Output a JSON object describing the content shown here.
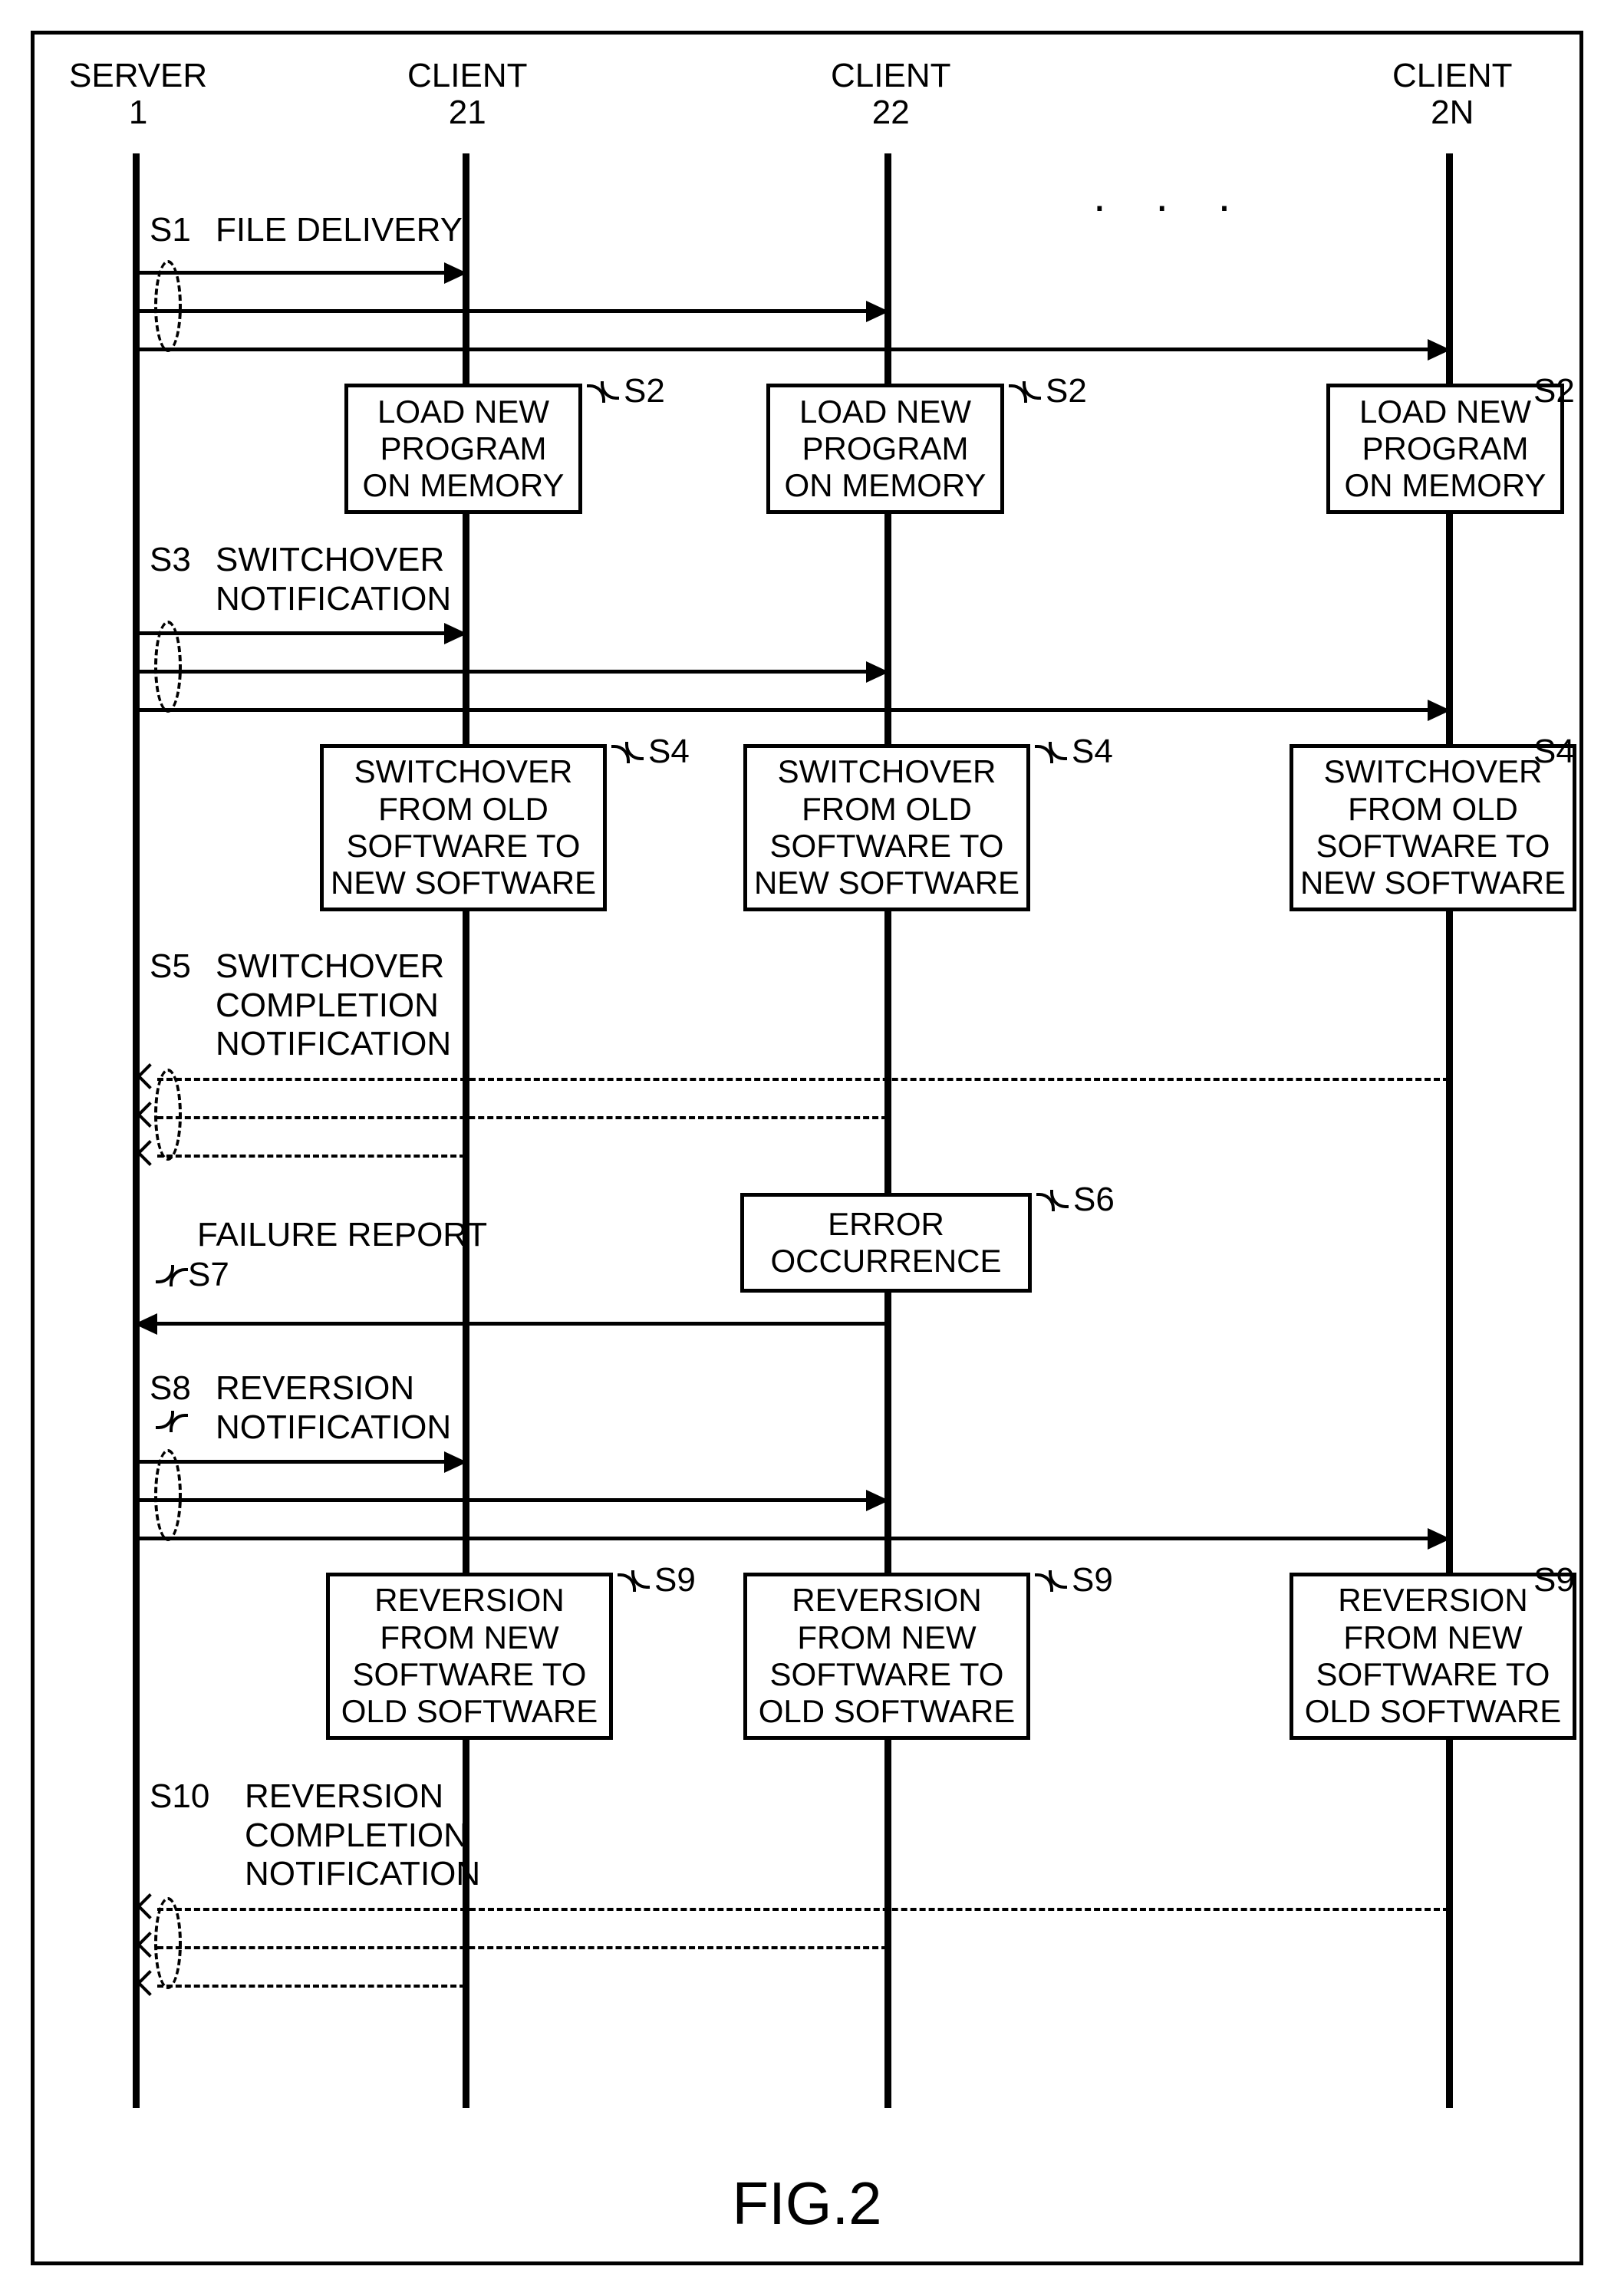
{
  "lifelines": {
    "server": {
      "label": "SERVER\n1"
    },
    "c21": {
      "label": "CLIENT\n21"
    },
    "c22": {
      "label": "CLIENT\n22"
    },
    "c2n": {
      "label": "CLIENT\n2N"
    }
  },
  "labels": {
    "S1": "S1",
    "S2": "S2",
    "S3": "S3",
    "S4": "S4",
    "S5": "S5",
    "S6": "S6",
    "S7": "S7",
    "S8": "S8",
    "S9": "S9",
    "S10": "S10"
  },
  "messages": {
    "file_delivery": "FILE DELIVERY",
    "switchover_notification": "SWITCHOVER\nNOTIFICATION",
    "switchover_completion": "SWITCHOVER\nCOMPLETION\nNOTIFICATION",
    "failure_report": "FAILURE REPORT",
    "reversion_notification": "REVERSION\nNOTIFICATION",
    "reversion_completion": "REVERSION\nCOMPLETION\nNOTIFICATION"
  },
  "boxes": {
    "load_new_program": "LOAD NEW\nPROGRAM\nON MEMORY",
    "switchover": "SWITCHOVER\nFROM OLD\nSOFTWARE TO\nNEW SOFTWARE",
    "error": "ERROR\nOCCURRENCE",
    "reversion": "REVERSION\nFROM NEW\nSOFTWARE TO\nOLD SOFTWARE"
  },
  "ellipsis": ". . .",
  "caption": "FIG.2",
  "chart_data": {
    "type": "sequence_diagram",
    "lifelines": [
      {
        "id": "server",
        "label": "SERVER 1"
      },
      {
        "id": "c21",
        "label": "CLIENT 21"
      },
      {
        "id": "c22",
        "label": "CLIENT 22"
      },
      {
        "id": "c2n",
        "label": "CLIENT 2N"
      }
    ],
    "steps": [
      {
        "id": "S1",
        "kind": "message",
        "from": "server",
        "to": [
          "c21",
          "c22",
          "c2n"
        ],
        "style": "solid",
        "text": "FILE DELIVERY"
      },
      {
        "id": "S2",
        "kind": "action",
        "at": [
          "c21",
          "c22",
          "c2n"
        ],
        "text": "LOAD NEW PROGRAM ON MEMORY"
      },
      {
        "id": "S3",
        "kind": "message",
        "from": "server",
        "to": [
          "c21",
          "c22",
          "c2n"
        ],
        "style": "solid",
        "text": "SWITCHOVER NOTIFICATION"
      },
      {
        "id": "S4",
        "kind": "action",
        "at": [
          "c21",
          "c22",
          "c2n"
        ],
        "text": "SWITCHOVER FROM OLD SOFTWARE TO NEW SOFTWARE"
      },
      {
        "id": "S5",
        "kind": "message",
        "from": [
          "c21",
          "c22",
          "c2n"
        ],
        "to": "server",
        "style": "dashed",
        "text": "SWITCHOVER COMPLETION NOTIFICATION"
      },
      {
        "id": "S6",
        "kind": "action",
        "at": [
          "c22"
        ],
        "text": "ERROR OCCURRENCE"
      },
      {
        "id": "S7",
        "kind": "message",
        "from": "c22",
        "to": "server",
        "style": "solid",
        "text": "FAILURE REPORT"
      },
      {
        "id": "S8",
        "kind": "message",
        "from": "server",
        "to": [
          "c21",
          "c22",
          "c2n"
        ],
        "style": "solid",
        "text": "REVERSION NOTIFICATION"
      },
      {
        "id": "S9",
        "kind": "action",
        "at": [
          "c21",
          "c22",
          "c2n"
        ],
        "text": "REVERSION FROM NEW SOFTWARE TO OLD SOFTWARE"
      },
      {
        "id": "S10",
        "kind": "message",
        "from": [
          "c21",
          "c22",
          "c2n"
        ],
        "to": "server",
        "style": "dashed",
        "text": "REVERSION COMPLETION NOTIFICATION"
      }
    ],
    "caption": "FIG.2"
  }
}
